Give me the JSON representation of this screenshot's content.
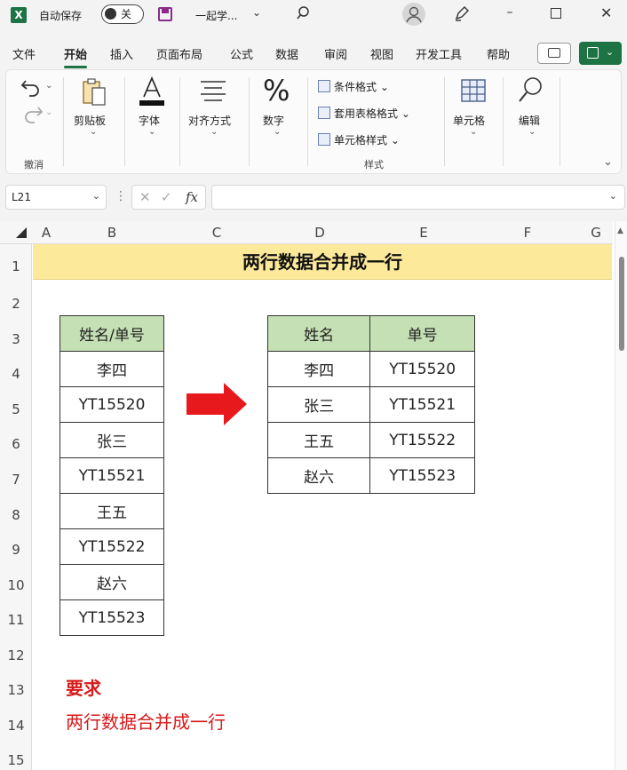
{
  "titlebar": {
    "app_icon": "X",
    "autosave_label": "自动保存",
    "autosave_state": "关",
    "doc_name": "一起学...",
    "doc_chevron": "⌄"
  },
  "window": {
    "minimize": "–",
    "close": "✕"
  },
  "menu": {
    "tabs": [
      "文件",
      "开始",
      "插入",
      "页面布局",
      "公式",
      "数据",
      "审阅",
      "视图",
      "开发工具",
      "帮助"
    ],
    "active_tab": "开始"
  },
  "ribbon": {
    "undo_group": "撤消",
    "clipboard": "剪贴板",
    "font": "字体",
    "align": "对齐方式",
    "number": "数字",
    "styles": {
      "cond_format": "条件格式",
      "table_format": "套用表格格式",
      "cell_style": "单元格样式",
      "caption": "样式"
    },
    "cells": "单元格",
    "edit": "编辑",
    "collapse": "⌄"
  },
  "formula_bar": {
    "name_box": "L21",
    "cancel": "✕",
    "enter": "✓",
    "fx": "fx",
    "formula": ""
  },
  "sheet": {
    "columns": [
      "A",
      "B",
      "C",
      "D",
      "E",
      "F",
      "G"
    ],
    "rows": [
      "1",
      "2",
      "3",
      "4",
      "5",
      "6",
      "7",
      "8",
      "9",
      "10",
      "11",
      "12",
      "13",
      "14",
      "15"
    ],
    "title": "两行数据合并成一行",
    "left_table": {
      "header": "姓名/单号",
      "cells": [
        "李四",
        "YT15520",
        "张三",
        "YT15521",
        "王五",
        "YT15522",
        "赵六",
        "YT15523"
      ]
    },
    "right_table": {
      "headers": [
        "姓名",
        "单号"
      ],
      "rows": [
        [
          "李四",
          "YT15520"
        ],
        [
          "张三",
          "YT15521"
        ],
        [
          "王五",
          "YT15522"
        ],
        [
          "赵六",
          "YT15523"
        ]
      ]
    },
    "requirement_title": "要求",
    "requirement_text": "两行数据合并成一行",
    "colors": {
      "title_band": "#fde99a",
      "header_fill": "#c5e0b4",
      "arrow": "#e8191c",
      "requirement": "#d71a1a"
    }
  }
}
